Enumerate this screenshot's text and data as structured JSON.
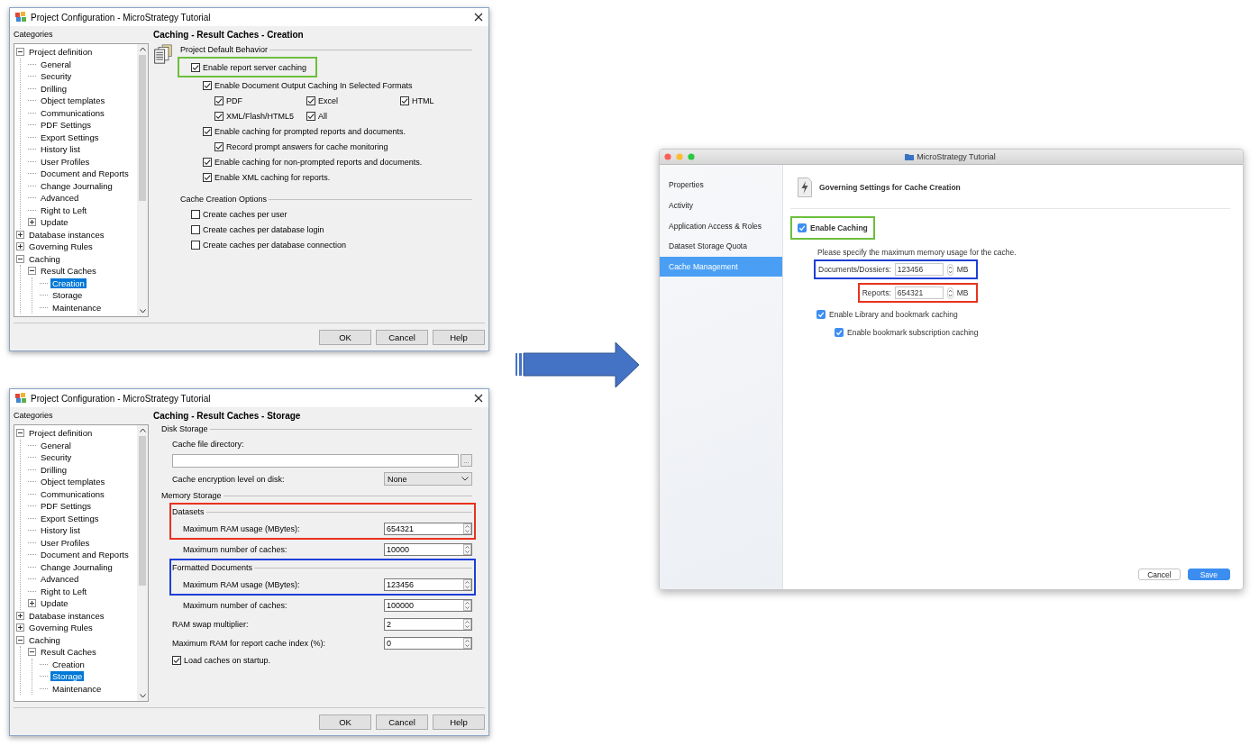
{
  "dialogs": [
    {
      "title": "Project Configuration - MicroStrategy Tutorial",
      "categories_label": "Categories",
      "tree": [
        {
          "label": "Project definition",
          "expanded": true,
          "selected": false,
          "children": [
            {
              "label": "General",
              "selected": false
            },
            {
              "label": "Security",
              "selected": false
            },
            {
              "label": "Drilling",
              "selected": false
            },
            {
              "label": "Object templates",
              "selected": false
            },
            {
              "label": "Communications",
              "selected": false
            },
            {
              "label": "PDF Settings",
              "selected": false
            },
            {
              "label": "Export Settings",
              "selected": false
            },
            {
              "label": "History list",
              "selected": false
            },
            {
              "label": "User Profiles",
              "selected": false
            },
            {
              "label": "Document and Reports",
              "selected": false
            },
            {
              "label": "Change Journaling",
              "selected": false
            },
            {
              "label": "Advanced",
              "selected": false
            },
            {
              "label": "Right to Left",
              "selected": false
            },
            {
              "label": "Update",
              "expanded": false,
              "selected": false
            }
          ]
        },
        {
          "label": "Database instances",
          "expanded": false,
          "selected": false
        },
        {
          "label": "Governing Rules",
          "expanded": false,
          "selected": false
        },
        {
          "label": "Caching",
          "expanded": true,
          "selected": false,
          "children": [
            {
              "label": "Result Caches",
              "expanded": true,
              "selected": false,
              "children": [
                {
                  "label": "Creation",
                  "selected": true
                },
                {
                  "label": "Storage",
                  "selected": false
                },
                {
                  "label": "Maintenance",
                  "selected": false
                }
              ]
            }
          ]
        }
      ],
      "page": {
        "kind": "creation",
        "heading": "Caching - Result Caches - Creation",
        "groups": [
          {
            "title": "Project Default Behavior",
            "options": [
              {
                "label": "Enable report server caching",
                "checked": true,
                "color": "#6cbf3c",
                "children": [
                  {
                    "label": "Enable Document Output Caching In Selected Formats",
                    "checked": true,
                    "formats": [
                      {
                        "label": "PDF",
                        "checked": true
                      },
                      {
                        "label": "Excel",
                        "checked": true
                      },
                      {
                        "label": "HTML",
                        "checked": true
                      },
                      {
                        "label": "XML/Flash/HTML5",
                        "checked": true
                      },
                      {
                        "label": "All",
                        "checked": true
                      }
                    ]
                  },
                  {
                    "label": "Enable caching for prompted reports and documents.",
                    "checked": true,
                    "children": [
                      {
                        "label": "Record prompt answers for cache monitoring",
                        "checked": true
                      }
                    ]
                  },
                  {
                    "label": "Enable caching for non-prompted reports and documents.",
                    "checked": true
                  },
                  {
                    "label": "Enable XML caching for reports.",
                    "checked": true
                  }
                ]
              }
            ]
          },
          {
            "title": "Cache Creation Options",
            "options": [
              {
                "label": "Create caches per user",
                "checked": false
              },
              {
                "label": "Create caches per database login",
                "checked": false
              },
              {
                "label": "Create caches per database connection",
                "checked": false
              }
            ]
          }
        ]
      },
      "buttons": [
        "OK",
        "Cancel",
        "Help"
      ]
    },
    {
      "title": "Project Configuration - MicroStrategy Tutorial",
      "categories_label": "Categories",
      "tree": [
        {
          "label": "Project definition",
          "expanded": true,
          "selected": false,
          "children": [
            {
              "label": "General",
              "selected": false
            },
            {
              "label": "Security",
              "selected": false
            },
            {
              "label": "Drilling",
              "selected": false
            },
            {
              "label": "Object templates",
              "selected": false
            },
            {
              "label": "Communications",
              "selected": false
            },
            {
              "label": "PDF Settings",
              "selected": false
            },
            {
              "label": "Export Settings",
              "selected": false
            },
            {
              "label": "History list",
              "selected": false
            },
            {
              "label": "User Profiles",
              "selected": false
            },
            {
              "label": "Document and Reports",
              "selected": false
            },
            {
              "label": "Change Journaling",
              "selected": false
            },
            {
              "label": "Advanced",
              "selected": false
            },
            {
              "label": "Right to Left",
              "selected": false
            },
            {
              "label": "Update",
              "expanded": false,
              "selected": false
            }
          ]
        },
        {
          "label": "Database instances",
          "expanded": false,
          "selected": false
        },
        {
          "label": "Governing Rules",
          "expanded": false,
          "selected": false
        },
        {
          "label": "Caching",
          "expanded": true,
          "selected": false,
          "children": [
            {
              "label": "Result Caches",
              "expanded": true,
              "selected": false,
              "children": [
                {
                  "label": "Creation",
                  "selected": false
                },
                {
                  "label": "Storage",
                  "selected": true
                },
                {
                  "label": "Maintenance",
                  "selected": false
                }
              ]
            }
          ]
        }
      ],
      "page": {
        "kind": "storage",
        "heading": "Caching - Result Caches - Storage",
        "disk_storage": {
          "title": "Disk Storage",
          "directory_label": "Cache file directory:",
          "browse_button": "...",
          "encryption_label": "Cache encryption level on disk:",
          "encryption_value": "None"
        },
        "memory_storage": {
          "title": "Memory Storage",
          "groups": [
            {
              "title": "Datasets",
              "color": "#e8321e",
              "fields": [
                {
                  "label": "Maximum RAM usage (MBytes):",
                  "value": "654321"
                },
                {
                  "label": "Maximum number of caches:",
                  "value": "10000"
                }
              ]
            },
            {
              "title": "Formatted Documents",
              "color": "#1f3fd6",
              "fields": [
                {
                  "label": "Maximum RAM usage (MBytes):",
                  "value": "123456"
                },
                {
                  "label": "Maximum number of caches:",
                  "value": "100000"
                }
              ]
            }
          ],
          "fields": [
            {
              "label": "RAM swap multiplier:",
              "value": "2"
            },
            {
              "label": "Maximum RAM for report cache index (%):",
              "value": "0"
            }
          ],
          "load_on_startup": {
            "label": "Load caches on startup.",
            "checked": true
          }
        }
      },
      "buttons": [
        "OK",
        "Cancel",
        "Help"
      ]
    }
  ],
  "mac_window": {
    "title": "MicroStrategy Tutorial",
    "sidebar": [
      {
        "label": "Properties",
        "selected": false
      },
      {
        "label": "Activity",
        "selected": false
      },
      {
        "label": "Application Access & Roles",
        "selected": false
      },
      {
        "label": "Dataset Storage Quota",
        "selected": false
      },
      {
        "label": "Cache Management",
        "selected": true
      }
    ],
    "heading": "Governing Settings for Cache Creation",
    "enable": {
      "label": "Enable Caching",
      "checked": true,
      "color": "#6cbf3c"
    },
    "hint": "Please specify the maximum memory usage for the cache.",
    "limits": [
      {
        "label": "Documents/Dossiers:",
        "value": "123456",
        "unit": "MB",
        "color": "#1f3fd6"
      },
      {
        "label": "Reports:",
        "value": "654321",
        "unit": "MB",
        "color": "#e8321e"
      }
    ],
    "options": [
      {
        "label": "Enable Library and bookmark caching",
        "checked": true,
        "children": [
          {
            "label": "Enable bookmark subscription caching",
            "checked": true
          }
        ]
      }
    ],
    "buttons": [
      {
        "label": "Cancel",
        "primary": false
      },
      {
        "label": "Save",
        "primary": true
      }
    ]
  }
}
